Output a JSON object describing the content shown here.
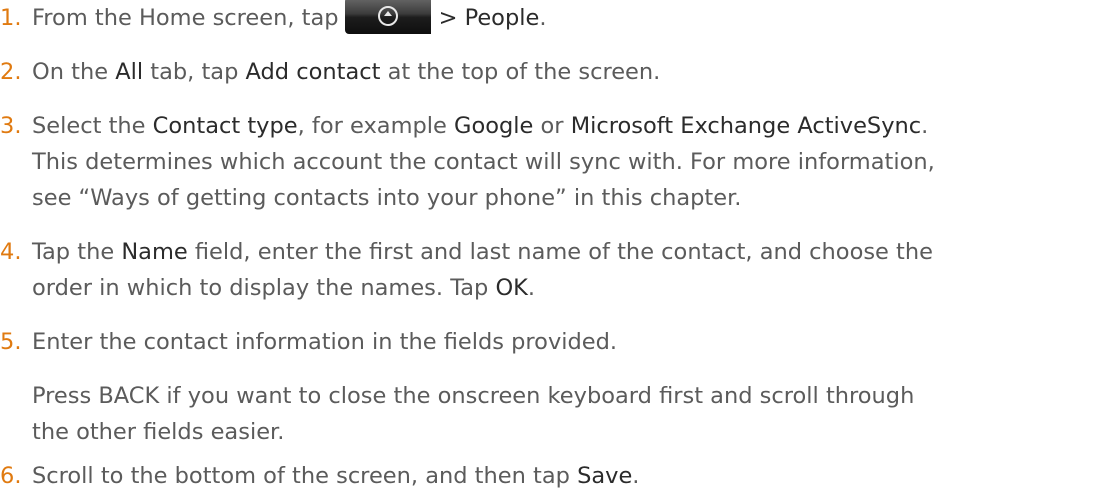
{
  "steps": [
    {
      "number": "1.",
      "t1": "From the Home screen, tap",
      "icon": "apps-launcher-icon",
      "t2": "> People",
      "t3": "."
    },
    {
      "number": "2.",
      "t1": "On the ",
      "k1": "All",
      "t2": " tab, tap ",
      "k2": "Add contact",
      "t3": " at the top of the screen."
    },
    {
      "number": "3.",
      "t1": "Select the ",
      "k1": "Contact type",
      "t2": ", for example ",
      "k2": "Google",
      "t3": " or ",
      "k3": "Microsoft Exchange ActiveSync",
      "t4": ".",
      "line2": "This determines which account the contact will sync with. For more information,",
      "line3": "see “Ways of getting contacts into your phone” in this chapter."
    },
    {
      "number": "4.",
      "t1": "Tap the ",
      "k1": "Name",
      "t2": " field, enter the first and last name of the contact, and choose the",
      "line2a": "order in which to display the names. Tap ",
      "k2": "OK",
      "line2b": "."
    },
    {
      "number": "5.",
      "t1": "Enter the contact information in the fields provided.",
      "note_line1": "Press BACK if you want to close the onscreen keyboard first and scroll through",
      "note_line2": "the other fields easier."
    },
    {
      "number": "6.",
      "t1": "Scroll to the bottom of the screen, and then tap ",
      "k1": "Save",
      "t2": "."
    }
  ]
}
